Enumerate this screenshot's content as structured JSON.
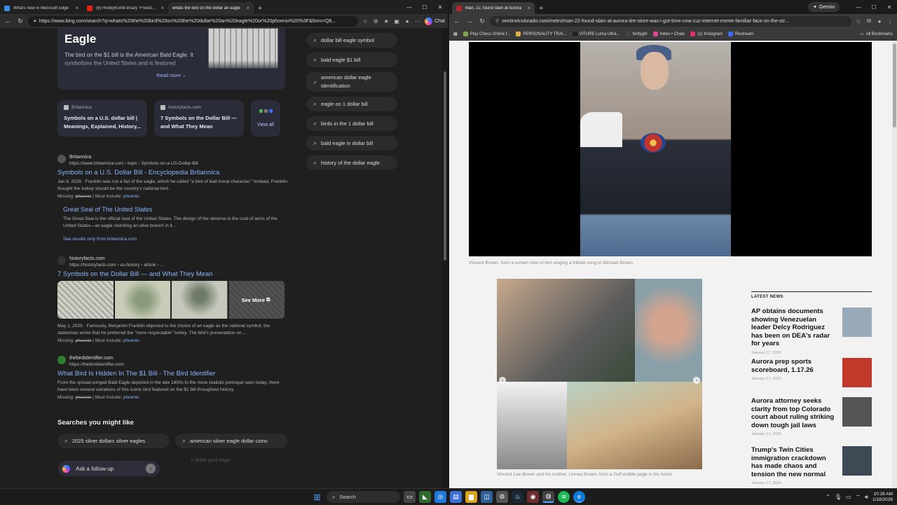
{
  "left_window": {
    "tabs": [
      {
        "label": "What's new in Microsoft Edge",
        "color": "#3a8ee6"
      },
      {
        "label": "(8) HoneyKomb Brazy \"Freestyle\"",
        "color": "#e62117"
      },
      {
        "label": "whats the bird on the dollar an eagle",
        "color": "#3a8ee6",
        "active": true
      }
    ],
    "address": "https://www.bing.com/search?q=whats%20the%20bird%20on%20the%20dollar%20an%20eagle%20or%20phoenix%20%3F&form=Q8...",
    "chat_label": "Chat",
    "knowledge_card": {
      "title": "Eagle",
      "description": "The bird on the $1 bill is the American Bald Eagle. It symbolizes the United States and is featured",
      "read_more": "Read more"
    },
    "source_cards": [
      {
        "source": "Britannica",
        "title": "Symbols on a U.S. dollar bill | Meanings, Explained, History..."
      },
      {
        "source": "historyfacts.com",
        "title": "7 Symbols on the Dollar Bill — and What They Mean"
      }
    ],
    "view_all": "View all",
    "results": [
      {
        "site": "Britannica",
        "url": "https://www.britannica.com › topic › Symbols-on-a-US-Dollar-Bill",
        "title": "Symbols on a U.S. Dollar Bill - Encyclopedia Britannica",
        "desc": "Jan 6, 2026 · Franklin was not a fan of the eagle, which he called \"a bird of bad moral character.\" Instead, Franklin thought the turkey should be the country's national bird.",
        "missing_label": "Missing:",
        "missing_term": "phoenix",
        "must_include": "Must include:",
        "must_term": "phoenix",
        "sub_title": "Great Seal of The United States",
        "sub_desc": "The Great Seal is the official seal of the United States. The design of the obverse is the coat of arms of the United States—an eagle clutching an olive branch in it...",
        "sub_link": "See results only from britannica.com"
      },
      {
        "site": "historyfacts.com",
        "url": "https://historyfacts.com › us-history › article › ...",
        "title": "7 Symbols on the Dollar Bill — and What They Mean",
        "see_more": "See More",
        "desc": "May 1, 2025 · Famously, Benjamin Franklin objected to the choice of an eagle as the national symbol; the statesman wrote that he preferred the \"more respectable\" turkey. The bird's presentation on ...",
        "missing_label": "Missing:",
        "missing_term": "phoenix",
        "must_include": "Must include:",
        "must_term": "phoenix"
      },
      {
        "site": "thebirdidentifier.com",
        "url": "https://thebirdidentifier.com",
        "title": "What Bird Is Hidden In The $1 Bill - The Bird Identifier",
        "desc": "From the spread-winged Bald Eagle depicted in the late 1800s to the more realistic portrayal seen today, there have been several variations of this iconic bird featured on the $1 bill throughout history.",
        "missing_label": "Missing:",
        "missing_term": "phoenix",
        "must_include": "Must include:",
        "must_term": "phoenix"
      }
    ],
    "related": [
      "dollar bill eagle symbol",
      "bald eagle $1 bill",
      "american dollar eagle identification",
      "eagle on 1 dollar bill",
      "birds in the 1 dollar bill",
      "bald eagle in dollar bill",
      "history of the dollar eagle"
    ],
    "searches_heading": "Searches you might like",
    "searches": [
      "2025 silver dollars silver eagles",
      "american silver eagle dollar coins"
    ],
    "follow_up": "Ask a follow-up",
    "ghost_text": "1 dollar gold eagle"
  },
  "right_window": {
    "tabs": [
      {
        "label": "Man, 22, found slain at Aurora",
        "color": "#b3262e",
        "active": true
      }
    ],
    "gemini": "Gemini",
    "address": "sentinelcolorado.com/metro/man-22-found-slain-at-aurora-tire-store-was-i-got-time-now-cuz-internet-meme-familiar-face-on-the-str...",
    "bookmarks": [
      {
        "label": "Play Chess Online f...",
        "color": "#7fa650"
      },
      {
        "label": "PERSONALITY TRAI...",
        "color": "#e0b04a"
      },
      {
        "label": "VITURE Luma Ultra...",
        "color": "#222222"
      },
      {
        "label": "fentygirl",
        "color": "#444444"
      },
      {
        "label": "Inbox • Chats",
        "color": "#d9478f"
      },
      {
        "label": "(1) Instagram",
        "color": "#e1306c"
      },
      {
        "label": "Restream",
        "color": "#3b6cf6"
      }
    ],
    "all_bookmarks": "All Bookmarks",
    "video_caption": "Vincent Brown, from a screen shot of him singing a tribute song to Michael Brown",
    "gallery_caption": "Vincent Lee Brown and his mother, Linnea Brown, from a GoFundMe page in his honor",
    "latest_heading": "LATEST NEWS",
    "latest": [
      {
        "title": "AP obtains documents showing Venezuelan leader Delcy Rodriguez has been on DEA's radar for years",
        "date": "January 17, 2026",
        "thumb": "#9aa9b7"
      },
      {
        "title": "Aurora prep sports scoreboard, 1.17.26",
        "date": "January 17, 2026",
        "thumb": "#c0392b"
      },
      {
        "title": "Aurora attorney seeks clarity from top Colorado court about ruling striking down tough jail laws",
        "date": "January 17, 2026",
        "thumb": "#555555"
      },
      {
        "title": "Trump's Twin Cities immigration crackdown has made chaos and tension the new normal",
        "date": "January 17, 2026",
        "thumb": "#3d4a55"
      }
    ]
  },
  "taskbar": {
    "search": "Search",
    "time": "10:28 AM",
    "date": "1/18/2026"
  }
}
